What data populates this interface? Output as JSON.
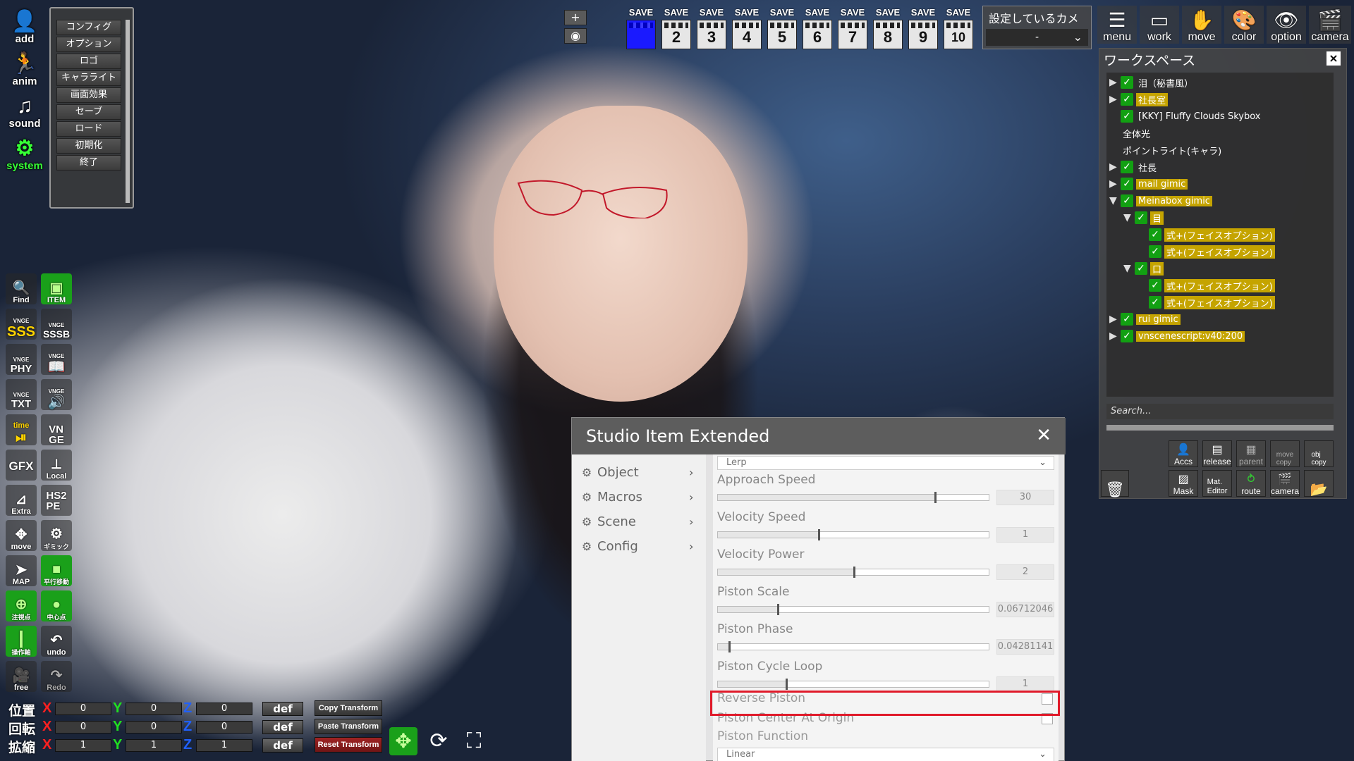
{
  "top_left": {
    "add_label": "add",
    "anim_label": "anim",
    "sound_label": "sound",
    "system_label": "system"
  },
  "system_menu": [
    "コンフィグ",
    "オプション",
    "ロゴ",
    "キャラライト",
    "画面効果",
    "セーブ",
    "ロード",
    "初期化",
    "終了"
  ],
  "tools": {
    "find": "Find",
    "item": "ITEM",
    "sss": "SSS",
    "sssb": "SSSB",
    "vnge": "VNGE",
    "phy": "PHY",
    "book": "",
    "txt": "TXT",
    "sound": "",
    "time": "time",
    "vnge2": "VN\nGE",
    "gfx": "GFX",
    "local": "Local",
    "extra": "Extra",
    "hs2pe": "HS2\nPE",
    "move": "move",
    "gimmick": "ギミック",
    "map": "MAP",
    "parallel": "平行移動",
    "focus": "注視点",
    "center": "中心点",
    "axis": "操作軸",
    "undo": "undo",
    "free": "free",
    "redo": "Redo"
  },
  "transform": {
    "rows": [
      {
        "label": "位置",
        "x": "0",
        "y": "0",
        "z": "0"
      },
      {
        "label": "回転",
        "x": "0",
        "y": "0",
        "z": "0"
      },
      {
        "label": "拡縮",
        "x": "1",
        "y": "1",
        "z": "1"
      }
    ],
    "axis_x": "X",
    "axis_y": "Y",
    "axis_z": "Z",
    "def_label": "def",
    "copy": "Copy Transform",
    "paste": "Paste Transform",
    "reset": "Reset Transform"
  },
  "top_center": {
    "plus": "+",
    "eye": "◉"
  },
  "saves": {
    "label": "SAVE",
    "slots": [
      "1",
      "2",
      "3",
      "4",
      "5",
      "6",
      "7",
      "8",
      "9",
      "10"
    ]
  },
  "camera_select": {
    "title": "設定しているカメラ",
    "value": "-"
  },
  "top_right": {
    "menu": "menu",
    "work": "work",
    "move": "move",
    "color": "color",
    "option": "option",
    "camera": "camera"
  },
  "workspace": {
    "title": "ワークスペース",
    "close": "×",
    "items": [
      {
        "name": "泪（秘書風）",
        "arrow": "▶",
        "checked": true,
        "highlight": false,
        "indent": 0
      },
      {
        "name": "社長室",
        "arrow": "▶",
        "checked": true,
        "highlight": true,
        "indent": 0
      },
      {
        "name": "[KKY] Fluffy Clouds Skybox",
        "arrow": "",
        "checked": true,
        "highlight": false,
        "indent": 0
      },
      {
        "name": "全体光",
        "arrow": "",
        "checked": false,
        "highlight": false,
        "indent": 0
      },
      {
        "name": "ポイントライト(キャラ)",
        "arrow": "",
        "checked": false,
        "highlight": false,
        "indent": 0
      },
      {
        "name": "社長",
        "arrow": "▶",
        "checked": true,
        "highlight": false,
        "indent": 0
      },
      {
        "name": "mail gimic",
        "arrow": "▶",
        "checked": true,
        "highlight": true,
        "indent": 0
      },
      {
        "name": "Meinabox gimic",
        "arrow": "▼",
        "checked": true,
        "highlight": true,
        "indent": 0
      },
      {
        "name": "目",
        "arrow": "▼",
        "checked": true,
        "highlight": true,
        "indent": 1
      },
      {
        "name": "式+(フェイスオプション)",
        "arrow": "",
        "checked": true,
        "highlight": true,
        "indent": 2
      },
      {
        "name": "式+(フェイスオプション)",
        "arrow": "",
        "checked": true,
        "highlight": true,
        "indent": 2
      },
      {
        "name": "口",
        "arrow": "▼",
        "checked": true,
        "highlight": true,
        "indent": 1
      },
      {
        "name": "式+(フェイスオプション)",
        "arrow": "",
        "checked": true,
        "highlight": true,
        "indent": 2
      },
      {
        "name": "式+(フェイスオプション)",
        "arrow": "",
        "checked": true,
        "highlight": true,
        "indent": 2
      },
      {
        "name": "rui gimic",
        "arrow": "▶",
        "checked": true,
        "highlight": true,
        "indent": 0
      },
      {
        "name": "vnscenescript:v40:200",
        "arrow": "▶",
        "checked": true,
        "highlight": true,
        "indent": 0
      }
    ],
    "search_placeholder": "Search...",
    "buttons": {
      "accs": "Accs",
      "release": "release",
      "parent": "parent",
      "move_copy": "move\ncopy",
      "obj_copy": "obj\ncopy",
      "mask": "Mask",
      "mat_editor": "Mat.\nEditor",
      "route": "route",
      "camera": "camera"
    }
  },
  "sie": {
    "title": "Studio Item Extended",
    "close": "✕",
    "nav": [
      {
        "label": "Object"
      },
      {
        "label": "Macros"
      },
      {
        "label": "Scene"
      },
      {
        "label": "Config"
      }
    ],
    "top_select": "Lerp",
    "params": [
      {
        "label": "Approach Speed",
        "value": "30",
        "ratio": 0.8
      },
      {
        "label": "Velocity Speed",
        "value": "1",
        "ratio": 0.37
      },
      {
        "label": "Velocity Power",
        "value": "2",
        "ratio": 0.5
      },
      {
        "label": "Piston Scale",
        "value": "0.06712046",
        "ratio": 0.22
      },
      {
        "label": "Piston Phase",
        "value": "0.04281141",
        "ratio": 0.04
      },
      {
        "label": "Piston Cycle Loop",
        "value": "1",
        "ratio": 0.25
      }
    ],
    "toggles": [
      {
        "label": "Reverse Piston"
      },
      {
        "label": "Piston Center At Origin"
      }
    ],
    "function_label": "Piston Function",
    "function_value": "Linear"
  }
}
